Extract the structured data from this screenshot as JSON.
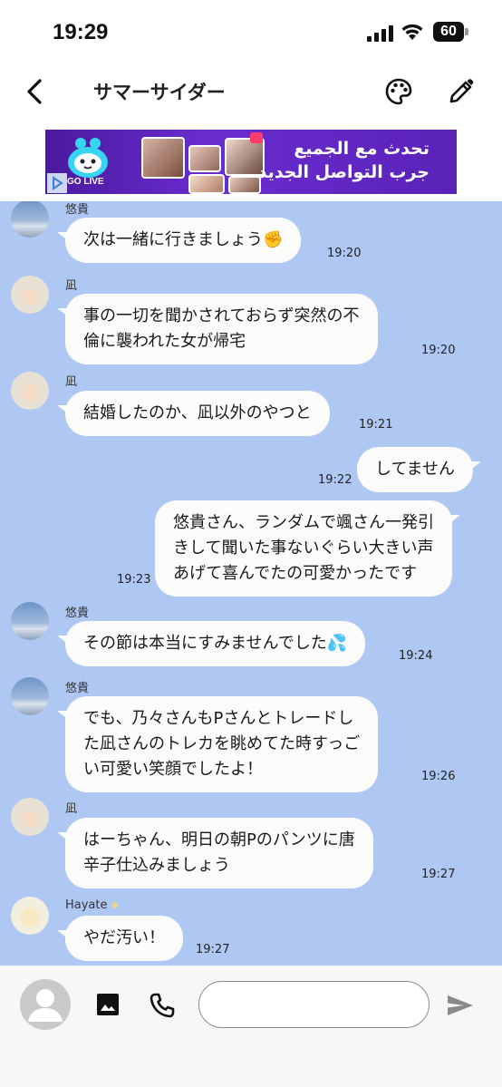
{
  "status_bar": {
    "time": "19:29",
    "battery": "60"
  },
  "header": {
    "title": "サマーサイダー",
    "icons": [
      "back-chevron-icon",
      "palette-icon",
      "edit-pencil-icon"
    ]
  },
  "ad": {
    "brand": "BIGO LIVE",
    "text_line1": "تحدث مع الجميع",
    "text_line2": "جرب التواصل الجديد"
  },
  "messages": [
    {
      "side": "left",
      "sender": "悠貴",
      "avatar": "sky",
      "text": "次は一緒に行きましょう✊",
      "time": "19:20"
    },
    {
      "side": "left",
      "sender": "凪",
      "avatar": "doll",
      "text": "事の一切を聞かされておらず突然の不\n倫に襲われた女が帰宅",
      "time": "19:20"
    },
    {
      "side": "left",
      "sender": "凪",
      "avatar": "doll",
      "text": "結婚したのか、凪以外のやつと",
      "time": "19:21"
    },
    {
      "side": "right",
      "text": "してません",
      "time": "19:22"
    },
    {
      "side": "right",
      "text": "悠貴さん、ランダムで颯さん一発引\nきして聞いた事ないぐらい大きい声\nあげて喜んでたの可愛かったです",
      "time": "19:23"
    },
    {
      "side": "left",
      "sender": "悠貴",
      "avatar": "sky",
      "text": "その節は本当にすみませんでした💦",
      "time": "19:24"
    },
    {
      "side": "left",
      "sender": "悠貴",
      "avatar": "sky",
      "text": "でも、乃々さんもPさんとトレードし\nた凪さんのトレカを眺めてた時すっご\nい可愛い笑顔でしたよ！",
      "time": "19:26"
    },
    {
      "side": "left",
      "sender": "凪",
      "avatar": "doll",
      "text": "はーちゃん、明日の朝Pのパンツに唐\n辛子仕込みましょう",
      "time": "19:27"
    },
    {
      "side": "left",
      "sender": "Hayate",
      "avatar": "hayate",
      "text": "やだ汚い！",
      "time": "19:27"
    }
  ],
  "input_bar": {
    "placeholder": "",
    "icons": [
      "profile-avatar-icon",
      "image-icon",
      "phone-icon",
      "send-icon"
    ]
  }
}
